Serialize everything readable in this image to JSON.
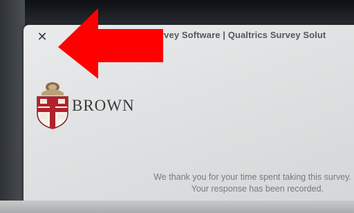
{
  "window": {
    "title": "rvey Software | Qualtrics Survey Solut",
    "close_glyph": "✕"
  },
  "brand": {
    "name": "BROWN",
    "logo_icon": "brown-university-shield-icon"
  },
  "message": {
    "line1": "We thank you for your time spent taking this survey.",
    "line2": "Your response has been recorded."
  },
  "annotation": {
    "icon": "red-arrow-icon",
    "color": "#ff0000"
  },
  "colors": {
    "accent_red": "#c8102e",
    "screen_bg": "#e6e8e9"
  }
}
